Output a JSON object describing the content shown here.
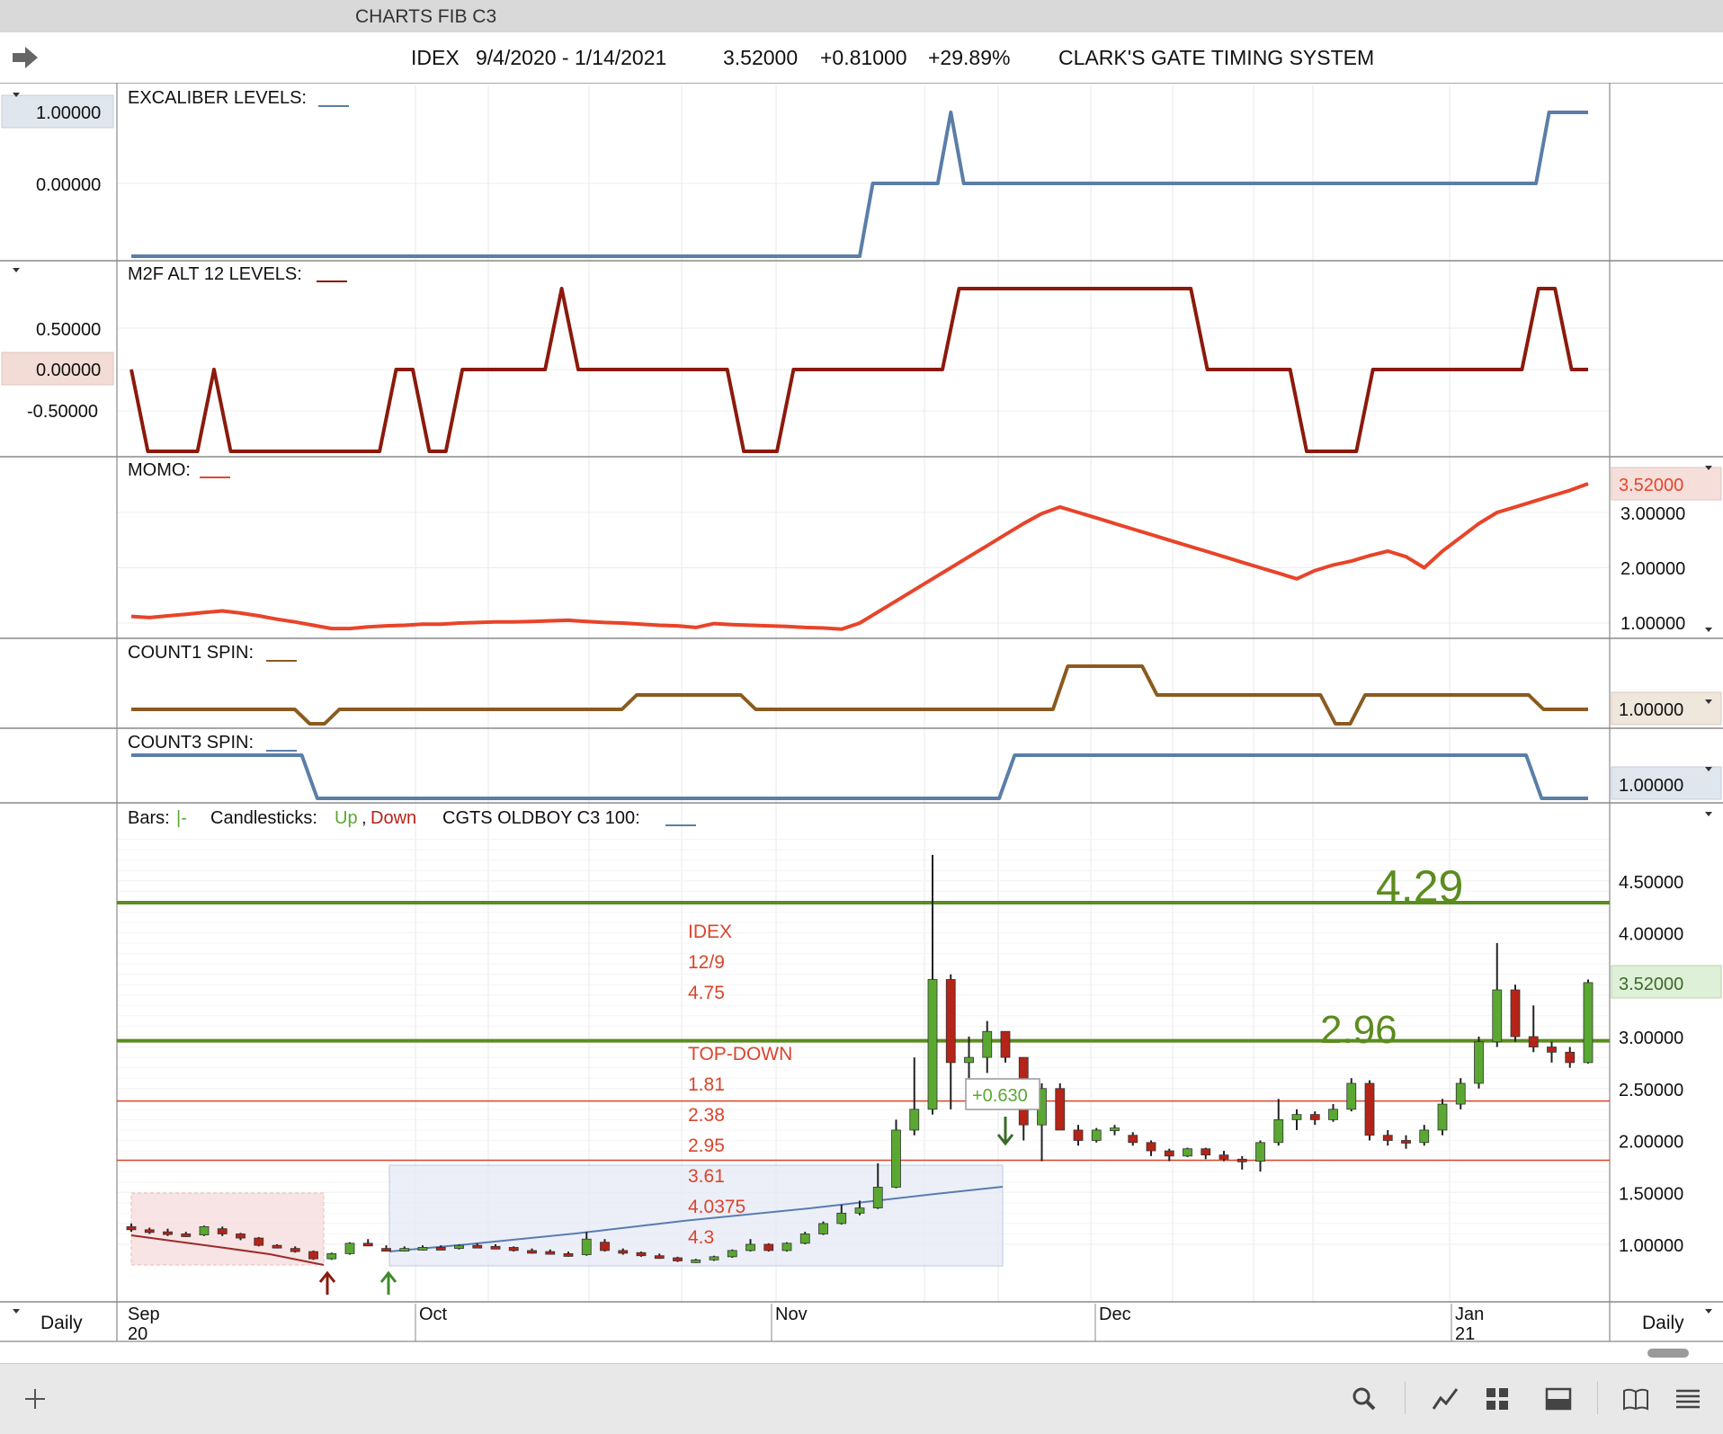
{
  "window": {
    "title": "CHARTS FIB C3"
  },
  "header": {
    "symbol": "IDEX",
    "date_range": "9/4/2020 - 1/14/2021",
    "last": "3.52000",
    "change": "+0.81000",
    "change_pct": "+29.89%",
    "system": "CLARK'S GATE TIMING SYSTEM"
  },
  "colors": {
    "blue": "#5b7ea8",
    "darkred": "#8b1a0c",
    "orange": "#e8442a",
    "brown": "#8b5a1f",
    "green": "#5b8c1e",
    "red_line": "#d9452c",
    "up": "#5aa832",
    "down": "#b52418"
  },
  "panels": {
    "excaliber": {
      "label": "EXCALIBER LEVELS:",
      "ticks": [
        "1.00000",
        "0.00000"
      ]
    },
    "m2f": {
      "label": "M2F ALT 12 LEVELS:",
      "ticks": [
        "0.50000",
        "0.00000",
        "-0.50000"
      ]
    },
    "momo": {
      "label": "MOMO:",
      "ticks": [
        "3.00000",
        "2.00000",
        "1.00000"
      ],
      "last_badge": "3.52000"
    },
    "count1": {
      "label": "COUNT1 SPIN:",
      "last_badge": "1.00000"
    },
    "count3": {
      "label": "COUNT3 SPIN:",
      "last_badge": "1.00000"
    },
    "price": {
      "label_bars": "Bars:",
      "label_candles": "Candlesticks:",
      "label_up": "Up",
      "label_down": "Down",
      "label_study": "CGTS OLDBOY  C3 100:",
      "ticks": [
        "4.50000",
        "4.00000",
        "3.00000",
        "2.50000",
        "2.00000",
        "1.50000",
        "1.00000"
      ],
      "last_badge": "3.52000",
      "level_high": "4.29",
      "level_mid": "2.96",
      "gain_box": "+0.630",
      "annotations": [
        "IDEX",
        "12/9",
        "4.75",
        "TOP-DOWN",
        "1.81",
        "2.38",
        "2.95",
        "3.61",
        "4.0375",
        "4.3"
      ]
    }
  },
  "xaxis": {
    "months": [
      "Sep",
      "Oct",
      "Nov",
      "Dec",
      "Jan"
    ],
    "years": [
      "20",
      "21"
    ],
    "period_left": "Daily",
    "period_right": "Daily"
  },
  "chart_data": {
    "type": "line",
    "title": "IDEX  9/4/2020 - 1/14/2021",
    "price_ylim": [
      0.8,
      4.85
    ],
    "horizontal_levels": [
      4.29,
      2.96,
      2.38,
      1.81
    ],
    "series": [
      {
        "name": "EXCALIBER LEVELS",
        "values": [
          -1,
          -1,
          -1,
          -1,
          -1,
          -1,
          -1,
          -1,
          -1,
          -1,
          -1,
          -1,
          -1,
          -1,
          -1,
          -1,
          -1,
          -1,
          -1,
          -1,
          -1,
          -1,
          -1,
          -1,
          -1,
          -1,
          -1,
          -1,
          -1,
          -1,
          -1,
          -1,
          -1,
          -1,
          -1,
          -1,
          -1,
          -1,
          -1,
          -1,
          -1,
          -1,
          -1,
          -1,
          -1,
          -1,
          -1,
          -1,
          -1,
          -1,
          -1,
          -1,
          -1,
          -1,
          -1,
          -1,
          -1,
          0,
          0,
          0,
          0,
          0,
          0,
          1,
          0,
          0,
          0,
          0,
          0,
          0,
          0,
          0,
          0,
          0,
          0,
          0,
          0,
          0,
          0,
          0,
          0,
          0,
          0,
          0,
          0,
          0,
          0,
          0,
          0,
          0,
          0,
          0,
          0,
          0,
          0,
          0,
          0,
          0,
          0,
          0,
          0,
          0,
          0,
          0,
          0,
          0,
          0,
          0,
          0,
          1,
          1,
          1,
          1
        ]
      },
      {
        "name": "M2F ALT 12 LEVELS",
        "values": [
          0,
          -1,
          -1,
          -1,
          -1,
          0,
          -1,
          -1,
          -1,
          -1,
          -1,
          -1,
          -1,
          -1,
          -1,
          -1,
          0,
          0,
          -1,
          -1,
          0,
          0,
          0,
          0,
          0,
          0,
          1,
          0,
          0,
          0,
          0,
          0,
          0,
          0,
          0,
          0,
          0,
          -1,
          -1,
          -1,
          0,
          0,
          0,
          0,
          0,
          0,
          0,
          0,
          0,
          0,
          1,
          1,
          1,
          1,
          1,
          1,
          1,
          1,
          1,
          1,
          1,
          1,
          1,
          1,
          1,
          0,
          0,
          0,
          0,
          0,
          0,
          -1,
          -1,
          -1,
          -1,
          0,
          0,
          0,
          0,
          0,
          0,
          0,
          0,
          0,
          0,
          1,
          1,
          0,
          0
        ]
      },
      {
        "name": "MOMO",
        "values": [
          1.12,
          1.1,
          1.13,
          1.16,
          1.19,
          1.22,
          1.18,
          1.13,
          1.07,
          1.02,
          0.96,
          0.9,
          0.9,
          0.93,
          0.95,
          0.96,
          0.98,
          0.98,
          1.0,
          1.01,
          1.02,
          1.02,
          1.03,
          1.04,
          1.05,
          1.03,
          1.01,
          1.0,
          0.98,
          0.96,
          0.95,
          0.92,
          0.99,
          0.97,
          0.96,
          0.95,
          0.94,
          0.92,
          0.91,
          0.89,
          1.0,
          1.2,
          1.4,
          1.6,
          1.8,
          2.0,
          2.2,
          2.4,
          2.6,
          2.8,
          2.98,
          3.1,
          3.0,
          2.9,
          2.8,
          2.7,
          2.6,
          2.5,
          2.4,
          2.3,
          2.2,
          2.1,
          2.0,
          1.9,
          1.8,
          1.95,
          2.05,
          2.12,
          2.22,
          2.3,
          2.2,
          2.0,
          2.3,
          2.55,
          2.8,
          3.0,
          3.1,
          3.2,
          3.3,
          3.4,
          3.52
        ]
      },
      {
        "name": "COUNT1 SPIN",
        "values": [
          1,
          1,
          1,
          1,
          1,
          1,
          1,
          1,
          1,
          1,
          1,
          1,
          0,
          0,
          1,
          1,
          1,
          1,
          1,
          1,
          1,
          1,
          1,
          1,
          1,
          1,
          1,
          1,
          1,
          1,
          1,
          1,
          1,
          1,
          2,
          2,
          2,
          2,
          2,
          2,
          2,
          2,
          1,
          1,
          1,
          1,
          1,
          1,
          1,
          1,
          1,
          1,
          1,
          1,
          1,
          1,
          1,
          1,
          1,
          1,
          1,
          1,
          1,
          3,
          3,
          3,
          3,
          3,
          3,
          2,
          2,
          2,
          2,
          2,
          2,
          2,
          2,
          2,
          2,
          2,
          2,
          0,
          0,
          2,
          2,
          2,
          2,
          2,
          2,
          2,
          2,
          2,
          2,
          2,
          2,
          1,
          1,
          1,
          1
        ]
      },
      {
        "name": "COUNT3 SPIN",
        "values": [
          1,
          1,
          1,
          1,
          1,
          1,
          1,
          1,
          1,
          1,
          1,
          1,
          0,
          0,
          0,
          0,
          0,
          0,
          0,
          0,
          0,
          0,
          0,
          0,
          0,
          0,
          0,
          0,
          0,
          0,
          0,
          0,
          0,
          0,
          0,
          0,
          0,
          0,
          0,
          0,
          0,
          0,
          0,
          0,
          0,
          0,
          0,
          0,
          0,
          0,
          0,
          0,
          0,
          0,
          0,
          0,
          0,
          1,
          1,
          1,
          1,
          1,
          1,
          1,
          1,
          1,
          1,
          1,
          1,
          1,
          1,
          1,
          1,
          1,
          1,
          1,
          1,
          1,
          1,
          1,
          1,
          1,
          1,
          1,
          1,
          1,
          1,
          1,
          1,
          1,
          1,
          0,
          0,
          0,
          0
        ]
      }
    ],
    "candles": [
      [
        1.17,
        1.2,
        1.12,
        1.14
      ],
      [
        1.14,
        1.16,
        1.1,
        1.12
      ],
      [
        1.12,
        1.15,
        1.08,
        1.1
      ],
      [
        1.1,
        1.12,
        1.07,
        1.09
      ],
      [
        1.09,
        1.18,
        1.08,
        1.17
      ],
      [
        1.15,
        1.17,
        1.08,
        1.1
      ],
      [
        1.1,
        1.11,
        1.04,
        1.06
      ],
      [
        1.06,
        1.07,
        0.98,
        0.99
      ],
      [
        0.99,
        1.0,
        0.96,
        0.97
      ],
      [
        0.96,
        0.98,
        0.92,
        0.93
      ],
      [
        0.93,
        0.94,
        0.85,
        0.86
      ],
      [
        0.86,
        0.92,
        0.85,
        0.91
      ],
      [
        0.91,
        1.02,
        0.9,
        1.01
      ],
      [
        1.01,
        1.05,
        0.99,
        1.0
      ],
      [
        0.96,
        0.99,
        0.94,
        0.95
      ],
      [
        0.95,
        0.98,
        0.93,
        0.96
      ],
      [
        0.96,
        0.99,
        0.94,
        0.97
      ],
      [
        0.97,
        0.99,
        0.95,
        0.96
      ],
      [
        0.96,
        1.0,
        0.95,
        0.99
      ],
      [
        0.99,
        1.01,
        0.97,
        0.98
      ],
      [
        0.98,
        1.0,
        0.96,
        0.97
      ],
      [
        0.97,
        0.98,
        0.93,
        0.94
      ],
      [
        0.94,
        0.96,
        0.91,
        0.93
      ],
      [
        0.93,
        0.95,
        0.9,
        0.91
      ],
      [
        0.91,
        0.93,
        0.88,
        0.9
      ],
      [
        0.9,
        1.12,
        0.89,
        1.05
      ],
      [
        1.02,
        1.05,
        0.93,
        0.94
      ],
      [
        0.94,
        0.96,
        0.9,
        0.92
      ],
      [
        0.92,
        0.93,
        0.88,
        0.89
      ],
      [
        0.89,
        0.91,
        0.86,
        0.87
      ],
      [
        0.87,
        0.88,
        0.83,
        0.84
      ],
      [
        0.84,
        0.86,
        0.82,
        0.85
      ],
      [
        0.85,
        0.89,
        0.84,
        0.88
      ],
      [
        0.88,
        0.95,
        0.87,
        0.94
      ],
      [
        0.94,
        1.05,
        0.93,
        1.0
      ],
      [
        1.0,
        1.01,
        0.93,
        0.94
      ],
      [
        0.94,
        1.02,
        0.93,
        1.01
      ],
      [
        1.01,
        1.12,
        1.0,
        1.1
      ],
      [
        1.1,
        1.22,
        1.09,
        1.2
      ],
      [
        1.2,
        1.38,
        1.19,
        1.3
      ],
      [
        1.3,
        1.42,
        1.28,
        1.35
      ],
      [
        1.35,
        1.78,
        1.34,
        1.55
      ],
      [
        1.55,
        2.2,
        1.54,
        2.1
      ],
      [
        2.1,
        2.8,
        2.05,
        2.3
      ],
      [
        2.3,
        4.75,
        2.25,
        3.55
      ],
      [
        3.55,
        3.6,
        2.3,
        2.75
      ],
      [
        2.75,
        3.0,
        2.6,
        2.8
      ],
      [
        2.8,
        3.15,
        2.65,
        3.05
      ],
      [
        3.05,
        3.05,
        2.75,
        2.8
      ],
      [
        2.8,
        2.8,
        2.0,
        2.15
      ],
      [
        2.15,
        2.55,
        1.8,
        2.5
      ],
      [
        2.5,
        2.55,
        2.1,
        2.1
      ],
      [
        2.1,
        2.15,
        1.95,
        2.0
      ],
      [
        2.0,
        2.12,
        1.98,
        2.1
      ],
      [
        2.1,
        2.15,
        2.05,
        2.12
      ],
      [
        2.05,
        2.08,
        1.95,
        1.98
      ],
      [
        1.98,
        2.0,
        1.85,
        1.9
      ],
      [
        1.9,
        1.92,
        1.8,
        1.85
      ],
      [
        1.85,
        1.93,
        1.84,
        1.92
      ],
      [
        1.92,
        1.93,
        1.82,
        1.86
      ],
      [
        1.86,
        1.9,
        1.8,
        1.82
      ],
      [
        1.82,
        1.85,
        1.72,
        1.8
      ],
      [
        1.8,
        2.0,
        1.7,
        1.98
      ],
      [
        1.98,
        2.4,
        1.95,
        2.2
      ],
      [
        2.2,
        2.3,
        2.1,
        2.25
      ],
      [
        2.25,
        2.28,
        2.15,
        2.2
      ],
      [
        2.2,
        2.35,
        2.18,
        2.3
      ],
      [
        2.3,
        2.6,
        2.28,
        2.55
      ],
      [
        2.55,
        2.58,
        2.0,
        2.05
      ],
      [
        2.05,
        2.1,
        1.95,
        2.0
      ],
      [
        2.0,
        2.05,
        1.92,
        1.98
      ],
      [
        1.98,
        2.15,
        1.95,
        2.1
      ],
      [
        2.1,
        2.4,
        2.05,
        2.35
      ],
      [
        2.35,
        2.6,
        2.3,
        2.55
      ],
      [
        2.55,
        3.0,
        2.5,
        2.95
      ],
      [
        2.95,
        3.9,
        2.9,
        3.45
      ],
      [
        3.45,
        3.5,
        2.95,
        3.0
      ],
      [
        3.0,
        3.3,
        2.85,
        2.9
      ],
      [
        2.9,
        2.95,
        2.75,
        2.85
      ],
      [
        2.85,
        2.9,
        2.7,
        2.75
      ],
      [
        2.75,
        3.55,
        2.74,
        3.52
      ]
    ]
  }
}
